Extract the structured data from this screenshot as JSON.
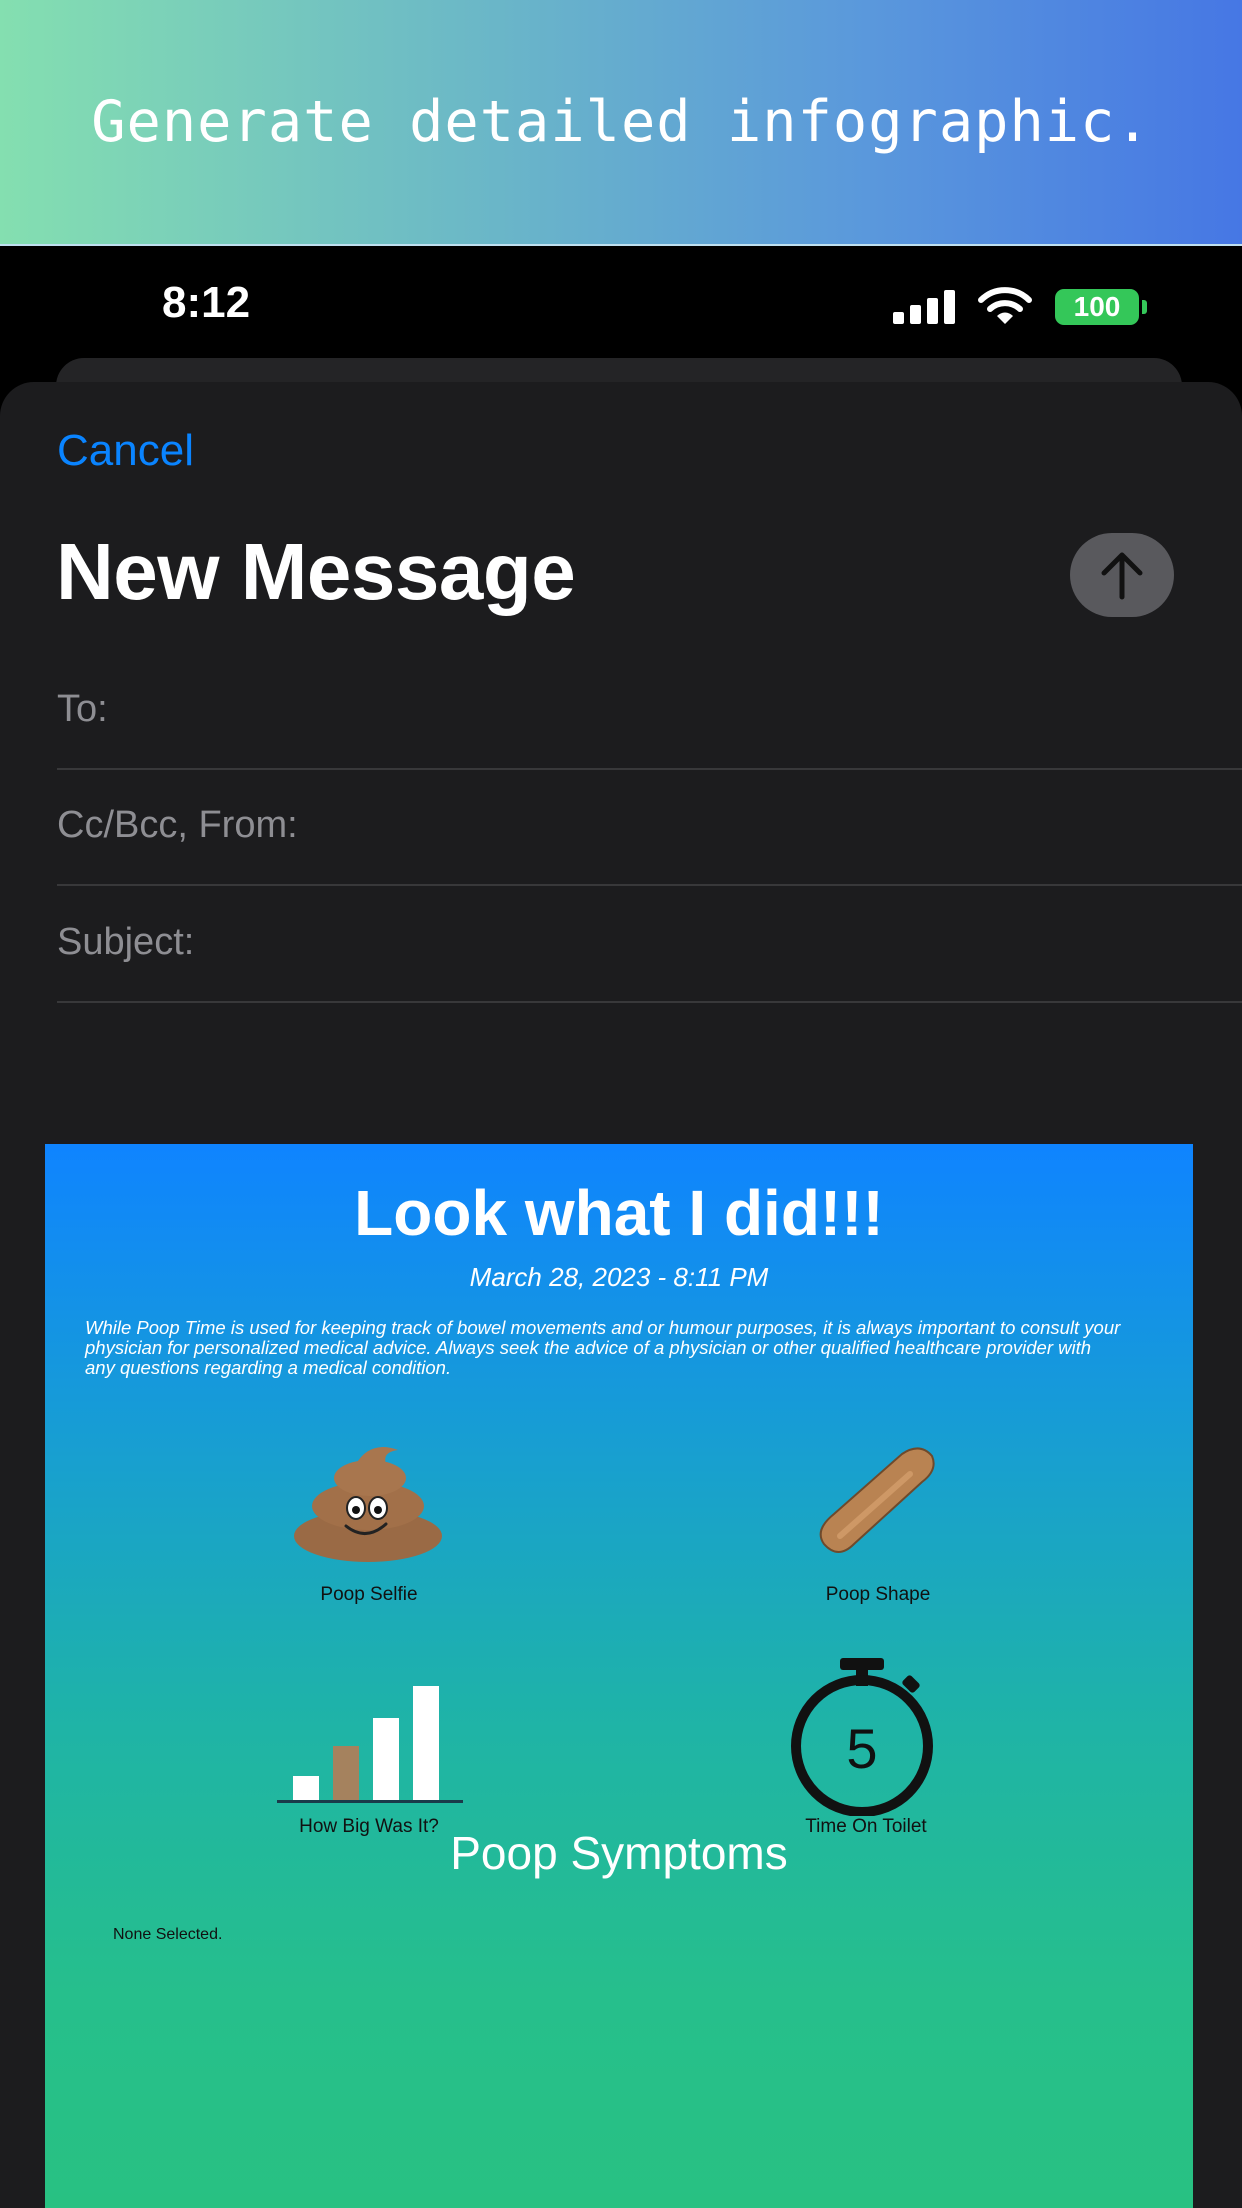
{
  "banner": {
    "text": "Generate detailed infographic."
  },
  "status_bar": {
    "time": "8:12",
    "battery": "100"
  },
  "compose": {
    "cancel_label": "Cancel",
    "title": "New Message",
    "fields": {
      "to_label": "To:",
      "cc_label": "Cc/Bcc, From:",
      "subject_label": "Subject:"
    }
  },
  "infographic": {
    "title": "Look what I did!!!",
    "date": "March 28, 2023 - 8:11 PM",
    "disclaimer": "While Poop Time is used for keeping track of bowel movements and or humour purposes, it is always important to consult your physician for personalized medical advice. Always seek the advice of a physician or other qualified healthcare provider with any questions regarding a medical condition.",
    "items": {
      "selfie_label": "Poop Selfie",
      "shape_label": "Poop Shape",
      "size_label": "How Big Was It?",
      "time_label": "Time On Toilet",
      "timer_value": "5"
    },
    "symptoms_title": "Poop Symptoms",
    "symptoms_value": "None Selected."
  },
  "colors": {
    "accent": "#0a84ff",
    "sheet_bg": "#1c1c1e",
    "battery": "#34c759",
    "poop_brown": "#9a6a45"
  }
}
